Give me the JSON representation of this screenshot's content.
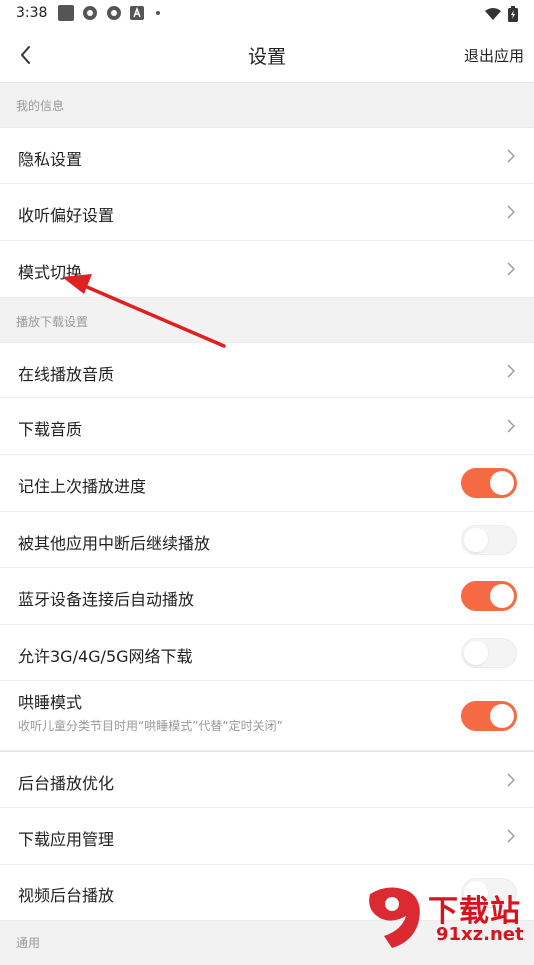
{
  "status_bar": {
    "time": "3:38"
  },
  "nav": {
    "title": "设置",
    "action": "退出应用"
  },
  "sections": {
    "my_info": "我的信息",
    "play_download": "播放下载设置",
    "general": "通用"
  },
  "rows": {
    "privacy": "隐私设置",
    "listen_pref": "收听偏好设置",
    "mode_switch": "模式切换",
    "online_quality": "在线播放音质",
    "download_quality": "下载音质",
    "remember_progress": "记住上次播放进度",
    "resume_after_interrupt": "被其他应用中断后继续播放",
    "bluetooth_autoplay": "蓝牙设备连接后自动播放",
    "allow_mobile_download": "允许3G/4G/5G网络下载",
    "sleep_mode": "哄睡模式",
    "sleep_mode_sub": "收听儿童分类节目时用“哄睡模式”代替“定时关闭”",
    "background_optimize": "后台播放优化",
    "download_app_manage": "下载应用管理",
    "video_background": "视频后台播放"
  },
  "toggles": {
    "remember_progress": true,
    "resume_after_interrupt": false,
    "bluetooth_autoplay": true,
    "allow_mobile_download": false,
    "sleep_mode": true
  },
  "colors": {
    "accent": "#f56a43",
    "annotation_arrow": "#e02020"
  },
  "watermark": {
    "brand": "下载站",
    "url": "91xz.net"
  }
}
